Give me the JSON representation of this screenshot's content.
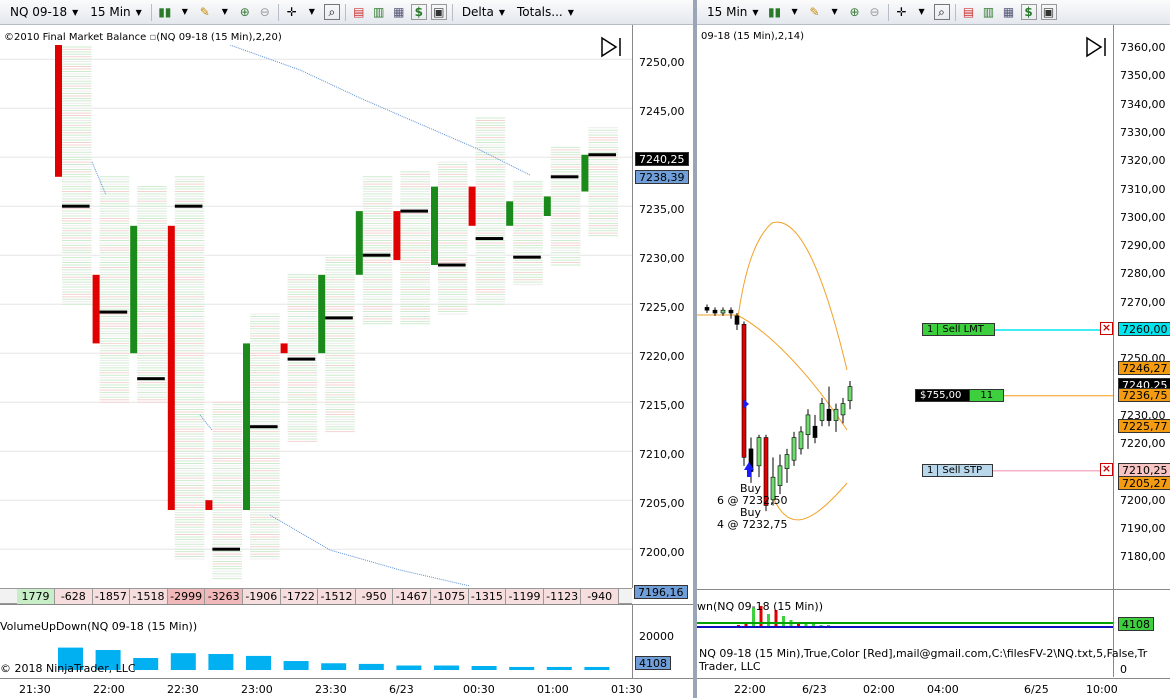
{
  "left": {
    "toolbar": {
      "instrument": "NQ 09-18",
      "interval": "15 Min",
      "delta_label": "Delta",
      "totals_label": "Totals..."
    },
    "indicator_title": "©2010 Final Market Balance",
    "series_title": "(NQ 09-18 (15 Min),2,20)",
    "panel_btn": "F",
    "price_labels": [
      "7250,00",
      "7245,00",
      "7240,00",
      "7235,00",
      "7230,00",
      "7225,00",
      "7220,00",
      "7215,00",
      "7210,00",
      "7205,00",
      "7200,00"
    ],
    "last_price": "7240,25",
    "line_price": "7238,39",
    "low_line_price": "7196,16",
    "delta_values": [
      "1779",
      "-628",
      "-1857",
      "-1518",
      "-2999",
      "-3263",
      "-1906",
      "-1722",
      "-1512",
      "-950",
      "-1467",
      "-1075",
      "-1315",
      "-1199",
      "-1123",
      "-940"
    ],
    "volume_title": "VolumeUpDown(NQ 09-18 (15 Min))",
    "volume_axis": "20000",
    "volume_tag": "4108",
    "copyright": "© 2018 NinjaTrader, LLC",
    "time_labels": [
      "21:30",
      "22:00",
      "22:30",
      "23:00",
      "23:30",
      "6/23",
      "00:30",
      "01:00",
      "01:30"
    ],
    "volumes": [
      1779,
      14000,
      12500,
      7500,
      10500,
      10000,
      8800,
      5600,
      4200,
      3800,
      2800,
      2800,
      2500,
      1900,
      1900,
      1900
    ],
    "candles": [
      {
        "o": 7252.5,
        "c": 7238.0,
        "h": 7252.5,
        "l": 7228.0,
        "poc": 7235.0
      },
      {
        "o": 7228.0,
        "c": 7221.0,
        "h": 7236.0,
        "l": 7218.0,
        "poc": 7224.2
      },
      {
        "o": 7220.0,
        "c": 7233.0,
        "h": 7235.0,
        "l": 7218.0,
        "poc": 7217.4
      },
      {
        "o": 7233.0,
        "c": 7204.0,
        "h": 7236.0,
        "l": 7202.0,
        "poc": 7235.0
      },
      {
        "o": 7205.0,
        "c": 7204.0,
        "h": 7213.0,
        "l": 7200.0,
        "poc": 7200.0
      },
      {
        "o": 7204.0,
        "c": 7221.0,
        "h": 7222.0,
        "l": 7202.0,
        "poc": 7212.5
      },
      {
        "o": 7221.0,
        "c": 7220.0,
        "h": 7226.0,
        "l": 7214.0,
        "poc": 7219.4
      },
      {
        "o": 7220.0,
        "c": 7228.0,
        "h": 7228.0,
        "l": 7215.0,
        "poc": 7223.6
      },
      {
        "o": 7228.0,
        "c": 7234.5,
        "h": 7236.0,
        "l": 7226.0,
        "poc": 7230.0
      },
      {
        "o": 7234.5,
        "c": 7229.5,
        "h": 7236.5,
        "l": 7226.0,
        "poc": 7234.5
      },
      {
        "o": 7229.0,
        "c": 7237.0,
        "h": 7237.5,
        "l": 7227.0,
        "poc": 7229.0
      },
      {
        "o": 7237.0,
        "c": 7233.0,
        "h": 7242.0,
        "l": 7228.0,
        "poc": 7231.7
      },
      {
        "o": 7233.0,
        "c": 7235.5,
        "h": 7235.5,
        "l": 7230.0,
        "poc": 7229.8
      },
      {
        "o": 7234.0,
        "c": 7236.0,
        "h": 7239.0,
        "l": 7232.0,
        "poc": 7238.0
      },
      {
        "o": 7236.5,
        "c": 7240.25,
        "h": 7241.0,
        "l": 7235.0,
        "poc": 7240.25
      }
    ]
  },
  "right": {
    "toolbar": {
      "interval": "15 Min"
    },
    "series_title": "09-18 (15 Min),2,14)",
    "panel_btn": "F",
    "price_labels": [
      "7360,00",
      "7350,00",
      "7340,00",
      "7330,00",
      "7320,00",
      "7310,00",
      "7300,00",
      "7290,00",
      "7280,00",
      "7270,00",
      "7260,00",
      "7250,00",
      "7240,00",
      "7230,00",
      "7220,00",
      "7210,00",
      "7200,00",
      "7190,00",
      "7180,00"
    ],
    "sell_lmt": {
      "qty": "1",
      "label": "Sell LMT",
      "price": "7260,00"
    },
    "sell_stp": {
      "qty": "1",
      "label": "Sell STP",
      "price": "7210,25"
    },
    "position": {
      "pnl": "$755,00",
      "qty": "11"
    },
    "tags": {
      "last": "7240,25",
      "t1": "7246,27",
      "t2": "7236,75",
      "t3": "7225,77",
      "t4": "7205,27"
    },
    "buy_annotations": [
      {
        "text": "Buy"
      },
      {
        "text": "6 @ 7232,50"
      },
      {
        "text": "Buy"
      },
      {
        "text": "4 @ 7232,75"
      }
    ],
    "volume_title": "wn(NQ 09-18 (15 Min))",
    "volume_tag": "4108",
    "volume_axis_zero": "0",
    "alert_text": "NQ 09-18 (15 Min),True,Color [Red],mail@gmail.com,C:\\filesFV-2\\NQ.txt,5,False,Tr",
    "copyright": "Trader, LLC",
    "time_labels": [
      "22:00",
      "6/23",
      "02:00",
      "04:00",
      "6/25",
      "10:00"
    ]
  },
  "colors": {
    "up": "#1a8a1a",
    "down": "#e00000",
    "poc": "#000000",
    "vol_bar": "#00b0f0",
    "vwap": "#5b8fd6",
    "band": "#f2a22a"
  }
}
